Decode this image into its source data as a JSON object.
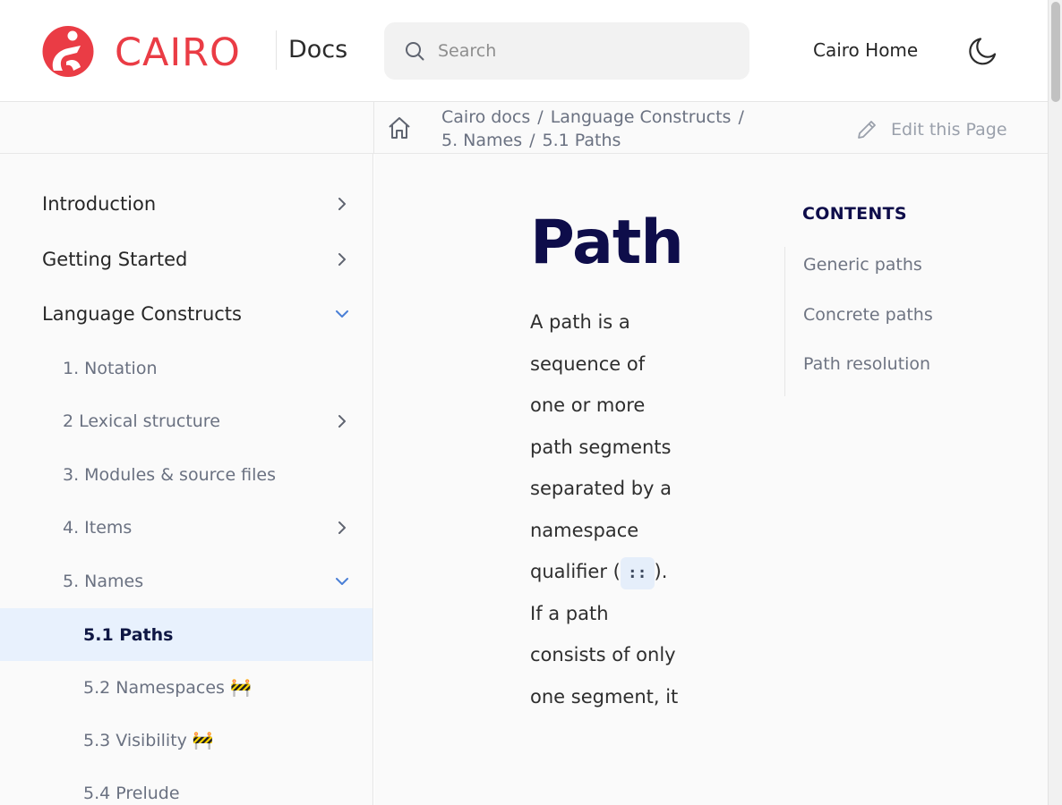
{
  "header": {
    "brand": "CAIRO",
    "docs_label": "Docs",
    "search_placeholder": "Search",
    "home_link": "Cairo Home"
  },
  "breadcrumb": {
    "items": [
      "Cairo docs",
      "Language Constructs",
      "5. Names",
      "5.1 Paths"
    ],
    "edit_label": "Edit this Page"
  },
  "sidebar": {
    "items": [
      {
        "label": "Introduction",
        "level": 1,
        "chevron": "right"
      },
      {
        "label": "Getting Started",
        "level": 1,
        "chevron": "right"
      },
      {
        "label": "Language Constructs",
        "level": 1,
        "chevron": "down"
      },
      {
        "label": "1. Notation",
        "level": 2,
        "chevron": "none"
      },
      {
        "label": "2 Lexical structure",
        "level": 2,
        "chevron": "right"
      },
      {
        "label": "3. Modules & source files",
        "level": 2,
        "chevron": "none"
      },
      {
        "label": "4. Items",
        "level": 2,
        "chevron": "right"
      },
      {
        "label": "5. Names",
        "level": 2,
        "chevron": "down"
      },
      {
        "label": "5.1 Paths",
        "level": 3,
        "chevron": "none",
        "active": true
      },
      {
        "label": "5.2 Namespaces 🚧",
        "level": 3,
        "chevron": "none"
      },
      {
        "label": "5.3 Visibility 🚧",
        "level": 3,
        "chevron": "none"
      },
      {
        "label": "5.4 Prelude",
        "level": 3,
        "chevron": "none"
      }
    ]
  },
  "content": {
    "title": "Path",
    "para_before": "A path is a sequence of one or more path segments separated by a namespace qualifier (",
    "code": "::",
    "para_after": "). If a path consists of only one segment, it"
  },
  "toc": {
    "title": "CONTENTS",
    "items": [
      "Generic paths",
      "Concrete paths",
      "Path resolution"
    ]
  },
  "colors": {
    "brand": "#ea3c45",
    "title": "#0e0d4a",
    "active_bg": "#e8f1fd",
    "chevron_down": "#4a7fd6"
  }
}
